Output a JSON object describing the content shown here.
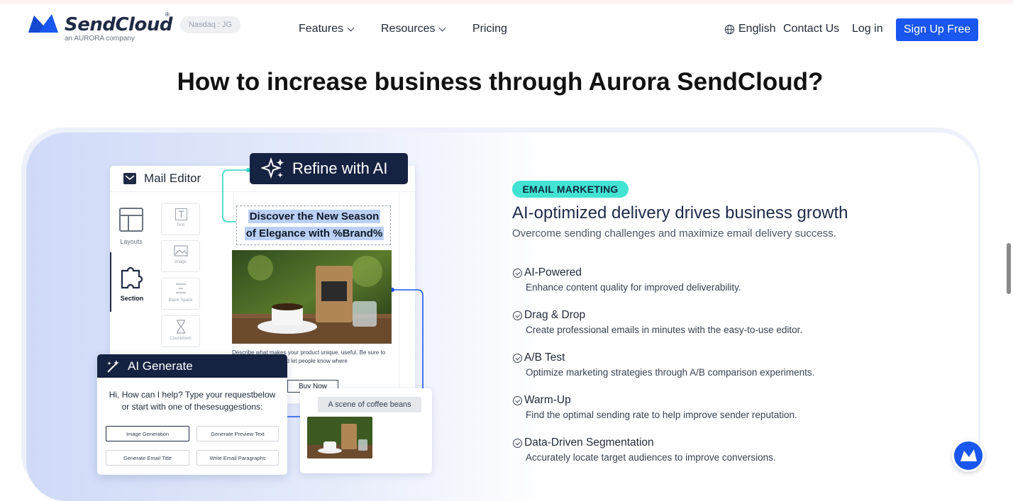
{
  "header": {
    "logo_text": "SendCloud",
    "logo_reg": "®",
    "logo_sub": "an AURORA company",
    "stock_badge": "Nasdaq : JG",
    "nav": [
      {
        "label": "Features",
        "has_caret": true
      },
      {
        "label": "Resources",
        "has_caret": true
      },
      {
        "label": "Pricing",
        "has_caret": false
      }
    ],
    "language": "English",
    "contact": "Contact Us",
    "login": "Log in",
    "signup": "Sign Up Free",
    "brand_color": "#1a56f0"
  },
  "headline": "How to increase business through Aurora SendCloud?",
  "feature": {
    "badge": "EMAIL MARKETING",
    "title": "AI-optimized delivery drives business growth",
    "subtitle": "Overcome sending challenges and maximize email delivery success.",
    "items": [
      {
        "title": "AI-Powered",
        "desc": "Enhance content quality for improved deliverability."
      },
      {
        "title": "Drag & Drop",
        "desc": "Create professional emails in minutes with the easy-to-use editor."
      },
      {
        "title": "A/B Test",
        "desc": "Optimize marketing strategies through A/B comparison experiments."
      },
      {
        "title": "Warm-Up",
        "desc": "Find the optimal sending rate to help improve sender reputation."
      },
      {
        "title": "Data-Driven Segmentation",
        "desc": "Accurately locate target audiences to improve conversions."
      }
    ]
  },
  "illustration": {
    "editor_title": "Mail Editor",
    "refine_label": "Refine with AI",
    "side_tabs": [
      "Layouts",
      "Section"
    ],
    "tiles": [
      "Text",
      "Image",
      "Blank Space",
      "Countdown"
    ],
    "headline_line1": "Discover the New Season",
    "headline_line2": "of Elegance with %Brand%",
    "description": "Describe what makes your product unique, useful. Be sure to highlight features , and let people know where",
    "buy_label": "Buy Now",
    "ai_title": "AI Generate",
    "ai_message": "Hi, How can I help? Type your requestbelow or start with one of thesesuggestions:",
    "chips": [
      "Image Generation",
      "Generate Preview Text",
      "Generate Email Title",
      "Write Email Paragraphs"
    ],
    "scene_prompt": "A scene of coffee beans"
  }
}
